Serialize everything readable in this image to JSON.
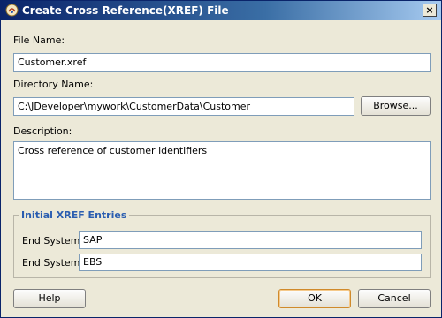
{
  "window": {
    "title": "Create Cross Reference(XREF) File",
    "close_glyph": "×"
  },
  "form": {
    "file_name_label": "File Name:",
    "file_name_value": "Customer.xref",
    "directory_label": "Directory Name:",
    "directory_value": "C:\\JDeveloper\\mywork\\CustomerData\\Customer",
    "browse_label": "Browse...",
    "description_label": "Description:",
    "description_value": "Cross reference of customer identifiers"
  },
  "xref_entries": {
    "title": "Initial XREF Entries",
    "rows": [
      {
        "label": "End System:",
        "value": "SAP"
      },
      {
        "label": "End System:",
        "value": "EBS"
      }
    ]
  },
  "buttons": {
    "help": "Help",
    "ok": "OK",
    "cancel": "Cancel"
  },
  "colors": {
    "title_bar": "#0a246a",
    "group_title": "#2a5db0",
    "dialog_bg": "#ece9d8"
  },
  "icons": {
    "app": "jdeveloper-icon",
    "close": "close-icon"
  }
}
